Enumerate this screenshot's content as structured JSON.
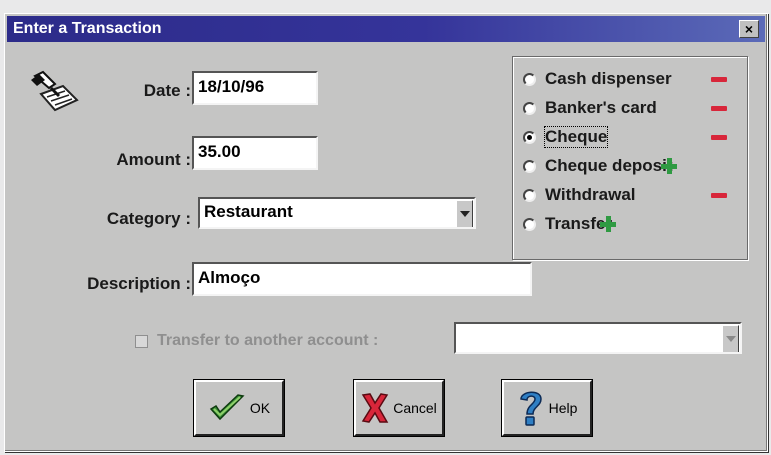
{
  "window": {
    "title": "Enter a Transaction",
    "close_glyph": "×"
  },
  "form": {
    "date": {
      "label": "Date :",
      "value": "18/10/96"
    },
    "amount": {
      "label": "Amount :",
      "value": "35.00"
    },
    "category": {
      "label": "Category :",
      "value": "Restaurant"
    },
    "description": {
      "label": "Description :",
      "value": "Almoço"
    },
    "transfer": {
      "label": "Transfer to another account :",
      "checked": false,
      "account": ""
    }
  },
  "transaction_types": [
    {
      "label": "Cash dispenser",
      "sign": "minus",
      "selected": false
    },
    {
      "label": "Banker's card",
      "sign": "minus",
      "selected": false
    },
    {
      "label": "Cheque",
      "sign": "minus",
      "selected": true
    },
    {
      "label": "Cheque deposit",
      "sign": "plus",
      "selected": false
    },
    {
      "label": "Withdrawal",
      "sign": "minus",
      "selected": false
    },
    {
      "label": "Transfer",
      "sign": "plus",
      "selected": false
    }
  ],
  "buttons": {
    "ok": "OK",
    "cancel": "Cancel",
    "help": "Help"
  },
  "colors": {
    "title_bar": "#2c2b89",
    "minus": "#d8263a",
    "plus": "#2f9a42",
    "dialog_bg": "#c5c5c4"
  }
}
